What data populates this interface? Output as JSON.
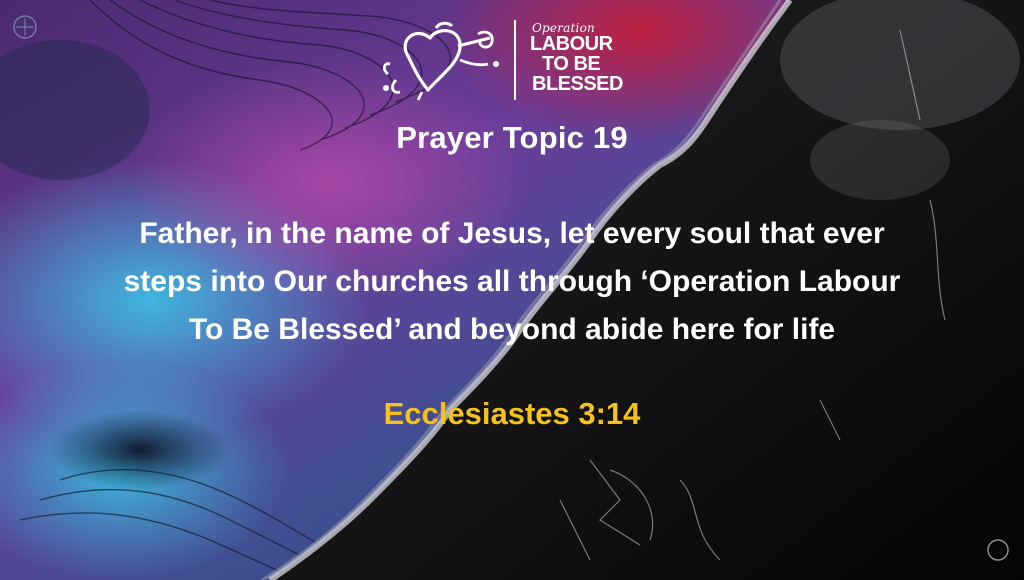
{
  "logo": {
    "icon": "heart-splash-icon",
    "small_text": "Operation",
    "line1": "LABOUR",
    "line2": "TO BE",
    "line3": "BLESSED"
  },
  "topic": "Prayer Topic 19",
  "prayer_lines": [
    "Father, in the name of Jesus, let every soul that ever",
    "steps into Our churches all through ‘Operation Labour",
    "To Be Blessed’ and beyond abide here for life"
  ],
  "scripture": "Ecclesiastes 3:14",
  "colors": {
    "text": "#ffffff",
    "scripture": "#f4c21a",
    "purple": "#5a2a8c",
    "cyan": "#2fb4d8",
    "red": "#c21f3a",
    "dark": "#0b0b0d"
  }
}
